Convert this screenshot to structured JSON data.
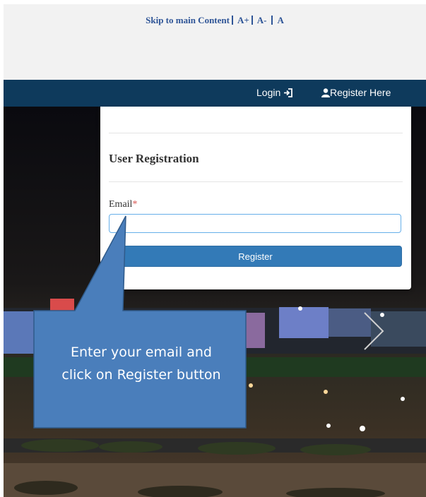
{
  "accessibility": {
    "skip_link": "Skip to main Content",
    "font_increase": "A+",
    "font_decrease": "A-",
    "font_reset": "A"
  },
  "nav": {
    "login": "Login",
    "register": "Register Here"
  },
  "form": {
    "title": "User Registration",
    "email_label": "Email",
    "required_mark": "*",
    "email_value": "",
    "submit_label": "Register"
  },
  "callout": {
    "line1": "Enter your email and",
    "line2": "click on Register button"
  },
  "colors": {
    "nav_bg": "#0e3a5c",
    "primary_button": "#337ab7",
    "callout_fill": "#4a7ebb",
    "link_blue": "#2f5597",
    "required": "#d9534f"
  },
  "icons": {
    "login": "sign-in-icon",
    "register": "user-icon",
    "carousel": "chevron-right-icon"
  }
}
